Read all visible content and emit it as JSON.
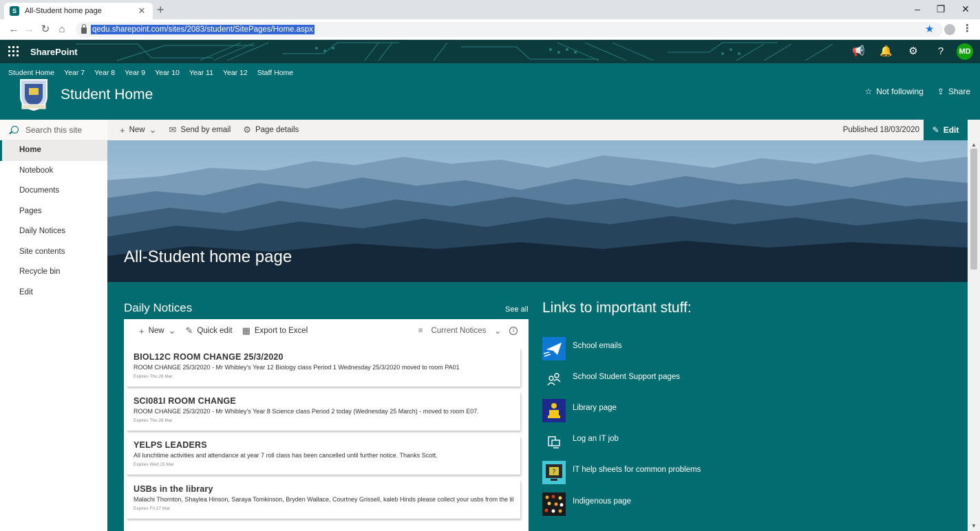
{
  "browser": {
    "tab_title": "All-Student home page",
    "url": "qedu.sharepoint.com/sites/2083/student/SitePages/Home.aspx"
  },
  "suite": {
    "title": "SharePoint",
    "avatar_initials": "MD"
  },
  "hubnav": [
    "Student Home",
    "Year 7",
    "Year 8",
    "Year 9",
    "Year 10",
    "Year 11",
    "Year 12",
    "Staff Home"
  ],
  "site": {
    "title": "Student Home",
    "follow_label": "Not following",
    "share_label": "Share"
  },
  "search": {
    "placeholder": "Search this site"
  },
  "leftnav": [
    "Home",
    "Notebook",
    "Documents",
    "Pages",
    "Daily Notices",
    "Site contents",
    "Recycle bin",
    "Edit"
  ],
  "commandbar": {
    "new": "New",
    "send": "Send by email",
    "details": "Page details",
    "published": "Published 18/03/2020",
    "edit": "Edit"
  },
  "hero": {
    "title": "All-Student home page"
  },
  "notices": {
    "header": "Daily Notices",
    "see_all": "See all",
    "cmd_new": "New",
    "cmd_quick_edit": "Quick edit",
    "cmd_export": "Export to Excel",
    "view": "Current Notices",
    "items": [
      {
        "title": "BIOL12C ROOM CHANGE 25/3/2020",
        "body": "ROOM CHANGE 25/3/2020 - Mr Whibley's Year 12 Biology class Period 1 Wednesday 25/3/2020 moved to room PA01",
        "expires": "Expires Thu 26 Mar"
      },
      {
        "title": "SCI081I ROOM CHANGE",
        "body": "ROOM CHANGE 25/3/2020 - Mr Whibley's Year 8 Science class Period 2 today (Wednesday 25 March) - moved to room E07.",
        "expires": "Expires Thu 26 Mar"
      },
      {
        "title": "YELPS LEADERS",
        "body": "All lunchtime activities and attendance at year 7 roll class has been cancelled until further notice. Thanks Scott.",
        "expires": "Expires Wed 25 Mar"
      },
      {
        "title": "USBs in the library",
        "body": "Malachi Thornton, Shaylea Hinson, Saraya Tomkinson, Bryden Wallace, Courtney Grissell, kaleb Hinds please collect your usbs from the library",
        "expires": "Expires Fri 27 Mar"
      }
    ]
  },
  "links": {
    "header": "Links to important stuff:",
    "items": [
      {
        "label": "School emails",
        "icon": "email-icon"
      },
      {
        "label": "School Student Support pages",
        "icon": "people-icon"
      },
      {
        "label": "Library page",
        "icon": "reader-icon"
      },
      {
        "label": "Log an IT job",
        "icon": "computer-icon"
      },
      {
        "label": "IT help sheets for common problems",
        "icon": "help-sheet-icon"
      },
      {
        "label": "Indigenous page",
        "icon": "dots-art-icon"
      }
    ]
  },
  "colors": {
    "theme": "#036c70",
    "suite": "#0b3b3d",
    "chrome": "#dee1e6",
    "avatar": "#13a10e"
  }
}
